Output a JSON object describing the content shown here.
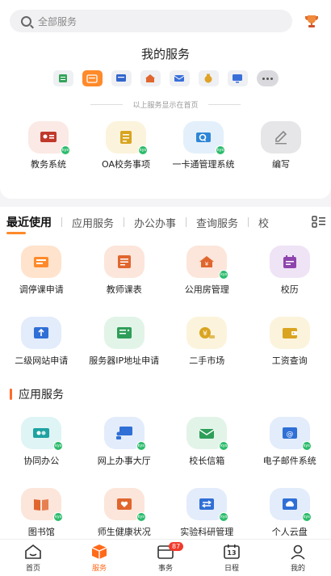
{
  "search": {
    "placeholder": "全部服务"
  },
  "my_services": {
    "title": "我的服务",
    "note": "以上服务显示在首页",
    "mini_icons": [
      {
        "name": "notes-icon",
        "color": "#34a35a",
        "bg": "#eef0f3"
      },
      {
        "name": "calendar-icon",
        "color": "#ffffff",
        "bg": "#ff8a2a"
      },
      {
        "name": "board-icon",
        "color": "#3366cc",
        "bg": "#eef0f3"
      },
      {
        "name": "house-icon",
        "color": "#e0662e",
        "bg": "#eef0f3"
      },
      {
        "name": "mail-icon",
        "color": "#3a6fd8",
        "bg": "#eef0f3"
      },
      {
        "name": "moneybag-icon",
        "color": "#e0a229",
        "bg": "#eef0f3"
      },
      {
        "name": "screen-icon",
        "color": "#3a6fd8",
        "bg": "#eef0f3"
      }
    ],
    "favorites": [
      {
        "label": "教务系统",
        "icon": "academic-icon",
        "color": "#c0392b",
        "bg": "#fbe9e5"
      },
      {
        "label": "OA校务事项",
        "icon": "checklist-icon",
        "color": "#d9a420",
        "bg": "#fbf3dc"
      },
      {
        "label": "一卡通管理系统",
        "icon": "card-icon",
        "color": "#2f86d6",
        "bg": "#e3f0fb"
      },
      {
        "label": "编写",
        "icon": "edit-icon",
        "color": "#888888",
        "bg": "#e6e6e8"
      }
    ]
  },
  "tabs": [
    "最近使用",
    "应用服务",
    "办公办事",
    "查询服务",
    "校"
  ],
  "recent": [
    {
      "label": "调停课申请",
      "icon": "reschedule-icon",
      "color": "#ff8a2a",
      "bg": "#ffe3cc"
    },
    {
      "label": "教师课表",
      "icon": "timetable-icon",
      "color": "#e0662e",
      "bg": "#fce5da"
    },
    {
      "label": "公用房管理",
      "icon": "house-icon",
      "color": "#e0662e",
      "bg": "#fce5da"
    },
    {
      "label": "校历",
      "icon": "calendar-icon",
      "color": "#8e44ad",
      "bg": "#efe3f6"
    },
    {
      "label": "二级网站申请",
      "icon": "usb-icon",
      "color": "#2f6fd6",
      "bg": "#e3ecfb"
    },
    {
      "label": "服务器IP地址申请",
      "icon": "server-icon",
      "color": "#2e9e58",
      "bg": "#e2f4e8"
    },
    {
      "label": "二手市场",
      "icon": "coin-icon",
      "color": "#d9a420",
      "bg": "#fbf3dc"
    },
    {
      "label": "工资查询",
      "icon": "wallet-icon",
      "color": "#d9a420",
      "bg": "#fbf3dc"
    }
  ],
  "app_section": {
    "title": "应用服务",
    "items": [
      {
        "label": "协同办公",
        "icon": "cooperate-icon",
        "color": "#1fa2a2",
        "bg": "#dff4f4"
      },
      {
        "label": "网上办事大厅",
        "icon": "presenter-icon",
        "color": "#2f6fd6",
        "bg": "#e3ecfb"
      },
      {
        "label": "校长信箱",
        "icon": "envelope-icon",
        "color": "#2e9e58",
        "bg": "#e2f4e8"
      },
      {
        "label": "电子邮件系统",
        "icon": "email-icon",
        "color": "#2f6fd6",
        "bg": "#e3ecfb"
      },
      {
        "label": "图书馆",
        "icon": "book-icon",
        "color": "#e0662e",
        "bg": "#fce5da"
      },
      {
        "label": "师生健康状况",
        "icon": "heart-icon",
        "color": "#e0662e",
        "bg": "#fce5da"
      },
      {
        "label": "实验科研管理",
        "icon": "lab-icon",
        "color": "#2f6fd6",
        "bg": "#e3ecfb"
      },
      {
        "label": "个人云盘",
        "icon": "cloud-icon",
        "color": "#2f6fd6",
        "bg": "#e3ecfb"
      }
    ]
  },
  "bottom_nav": [
    {
      "label": "首页",
      "icon": "home-icon"
    },
    {
      "label": "服务",
      "icon": "cube-icon"
    },
    {
      "label": "事务",
      "icon": "inbox-icon",
      "badge": "87"
    },
    {
      "label": "日程",
      "icon": "calendar-13-icon",
      "day": "13"
    },
    {
      "label": "我的",
      "icon": "profile-icon"
    }
  ],
  "colors": {
    "accent": "#ff8a2a",
    "active_nav": "#ff6a1a",
    "badge": "#f13a2b"
  }
}
